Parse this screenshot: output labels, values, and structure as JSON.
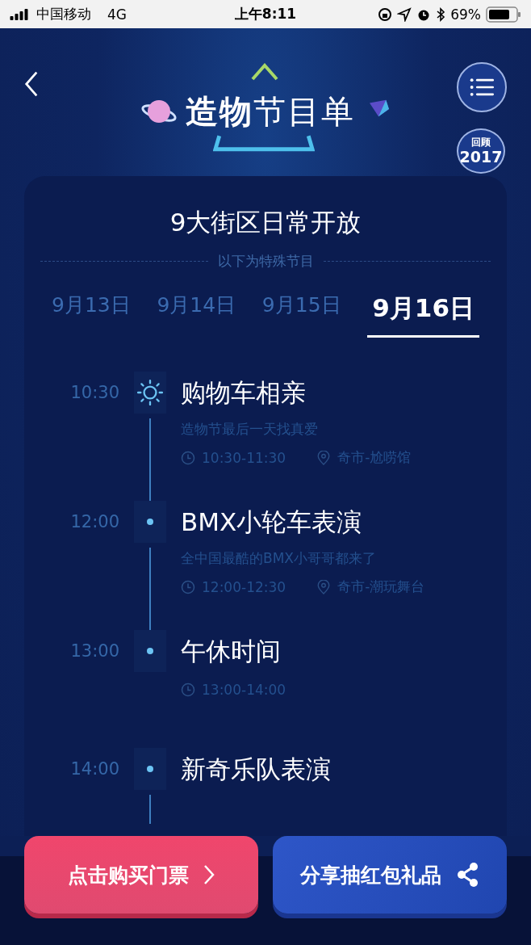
{
  "status_bar": {
    "carrier": "中国移动",
    "network": "4G",
    "time": "上午8:11",
    "battery": "69%"
  },
  "header": {
    "title": "**造物**节目单",
    "review_badge": {
      "line1": "回顾",
      "line2": "2017"
    }
  },
  "card": {
    "heading": "9大街区日常开放",
    "divider_label": "以下为特殊节目",
    "tabs": [
      {
        "label": "9月13日",
        "selected": false
      },
      {
        "label": "9月14日",
        "selected": false
      },
      {
        "label": "9月15日",
        "selected": false
      },
      {
        "label": "9月16日",
        "selected": true
      }
    ],
    "events": [
      {
        "time": "10:30",
        "active": true,
        "title": "购物车相亲",
        "subtitle": "造物节最后一天找真爱",
        "duration": "10:30-11:30",
        "location": "奇市-尬唠馆"
      },
      {
        "time": "12:00",
        "active": false,
        "title": "BMX小轮车表演",
        "subtitle": "全中国最酷的BMX小哥哥都来了",
        "duration": "12:00-12:30",
        "location": "奇市-潮玩舞台"
      },
      {
        "time": "13:00",
        "active": false,
        "title": "午休时间",
        "duration": "13:00-14:00"
      },
      {
        "time": "14:00",
        "active": false,
        "title": "新奇乐队表演"
      }
    ]
  },
  "buttons": {
    "buy": "点击购买门票",
    "share": "分享抽红包礼品"
  }
}
